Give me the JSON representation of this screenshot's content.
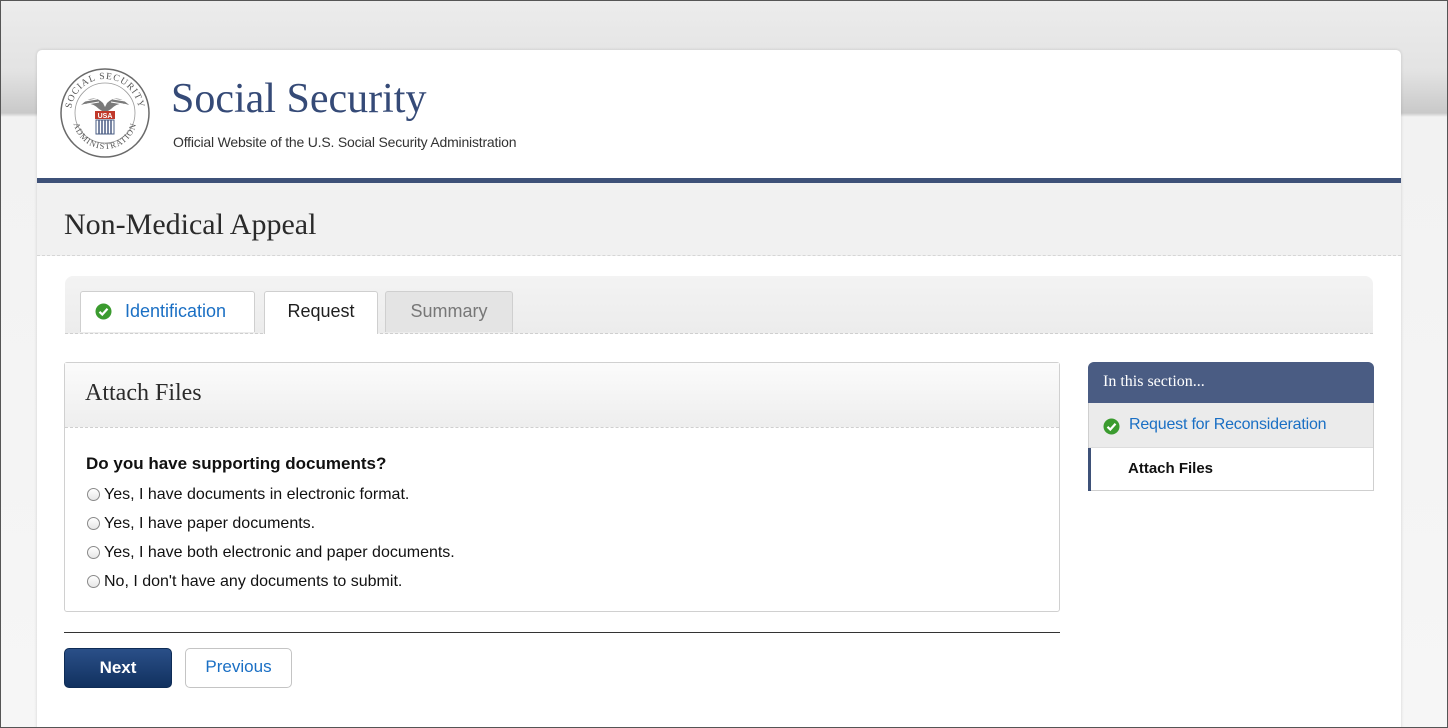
{
  "header": {
    "seal_text": [
      "SOCIAL SECURITY",
      "ADMINISTRATION",
      "USA"
    ],
    "title": "Social Security",
    "subtitle": "Official Website of the U.S. Social Security Administration"
  },
  "page": {
    "title": "Non-Medical Appeal"
  },
  "tabs": [
    {
      "label": "Identification",
      "state": "completed",
      "icon": "check-circle-icon"
    },
    {
      "label": "Request",
      "state": "active"
    },
    {
      "label": "Summary",
      "state": "disabled"
    }
  ],
  "panel": {
    "title": "Attach Files",
    "question": "Do you have supporting documents?",
    "options": [
      {
        "label": "Yes, I have documents in electronic format.",
        "selected": false
      },
      {
        "label": "Yes, I have paper documents.",
        "selected": false
      },
      {
        "label": "Yes, I have both electronic and paper documents.",
        "selected": false
      },
      {
        "label": "No, I don't have any documents to submit.",
        "selected": false
      }
    ]
  },
  "buttons": {
    "next": "Next",
    "previous": "Previous"
  },
  "sidebar": {
    "heading": "In this section...",
    "items": [
      {
        "label": "Request for Reconsideration",
        "state": "completed",
        "icon": "check-circle-icon"
      },
      {
        "label": "Attach Files",
        "state": "current"
      }
    ]
  },
  "colors": {
    "brand_navy": "#354a77",
    "header_rule": "#3e5178",
    "sidebar_header": "#4a5c83",
    "link_blue": "#1a6fc4",
    "check_green": "#3b9b2f",
    "next_button": "#1c3f74"
  }
}
